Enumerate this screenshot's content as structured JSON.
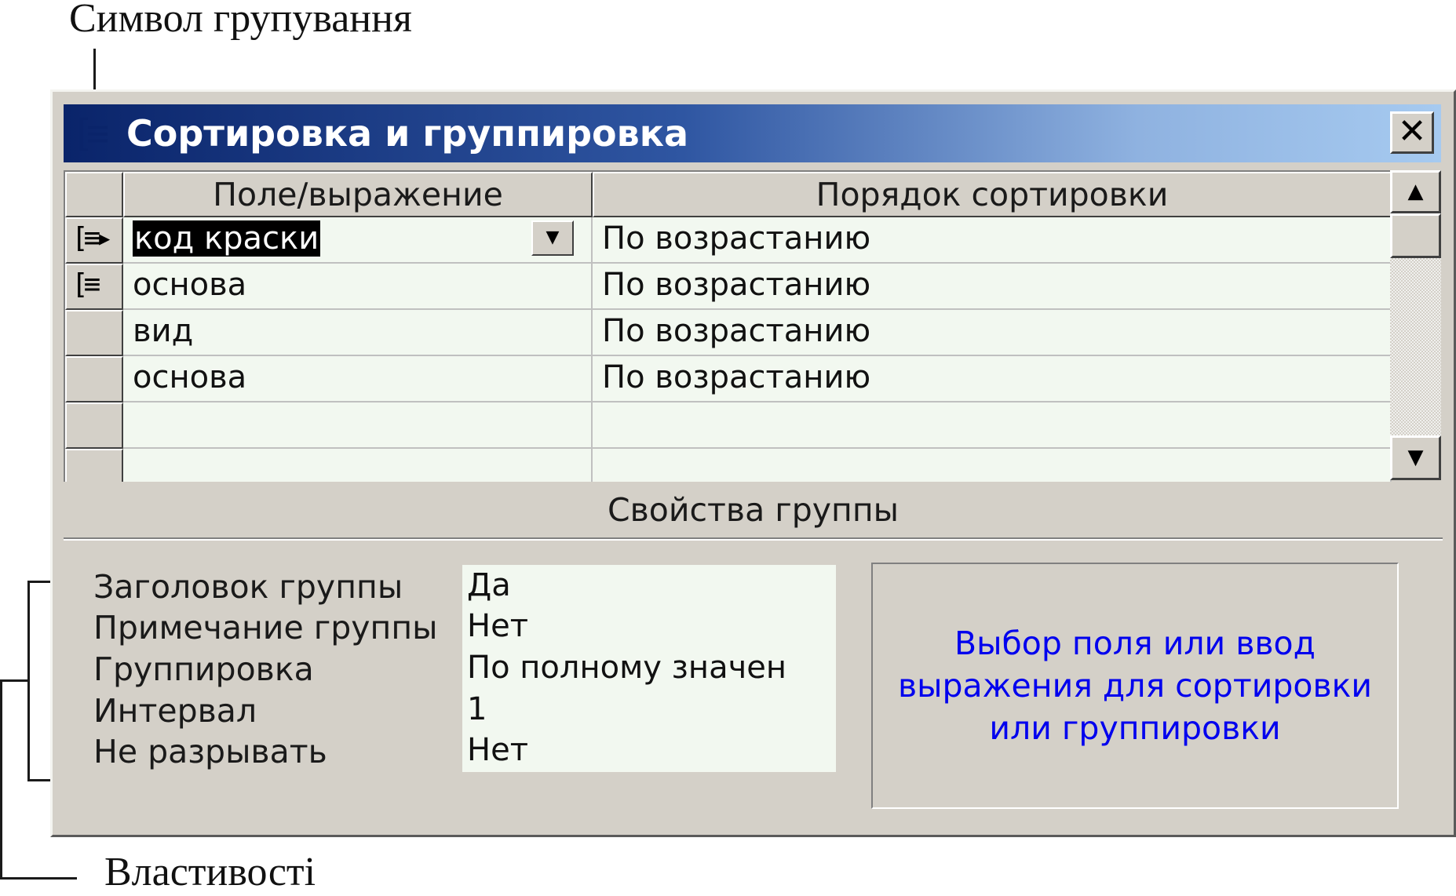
{
  "annotations": {
    "grouping_symbol": "Символ групування",
    "properties": "Властивості"
  },
  "window": {
    "title": "Сортировка и группировка",
    "title_icon": "sorting-grouping-icon",
    "close_label": "✕"
  },
  "grid": {
    "columns": [
      "Поле/выражение",
      "Порядок сортировки"
    ],
    "rows": [
      {
        "field": "код краски",
        "order": "По возрастанию",
        "grouped": true,
        "current": true
      },
      {
        "field": "основа",
        "order": "По возрастанию",
        "grouped": true,
        "current": false
      },
      {
        "field": "вид",
        "order": "По возрастанию",
        "grouped": false,
        "current": false
      },
      {
        "field": "основа",
        "order": "По возрастанию",
        "grouped": false,
        "current": false
      },
      {
        "field": "",
        "order": "",
        "grouped": false,
        "current": false
      },
      {
        "field": "",
        "order": "",
        "grouped": false,
        "current": false
      }
    ]
  },
  "group_properties": {
    "title": "Свойства группы",
    "items": [
      {
        "label": "Заголовок группы",
        "value": "Да"
      },
      {
        "label": "Примечание группы",
        "value": "Нет"
      },
      {
        "label": "Группировка",
        "value": "По полному значен"
      },
      {
        "label": "Интервал",
        "value": "1"
      },
      {
        "label": "Не разрывать",
        "value": "Нет"
      }
    ],
    "hint": "Выбор поля или ввод выражения для сортировки или группировки"
  },
  "colors": {
    "title_gradient_start": "#0a246a",
    "title_gradient_end": "#a6caf0",
    "hint_text": "#0000ee",
    "window_face": "#d4d0c8"
  }
}
